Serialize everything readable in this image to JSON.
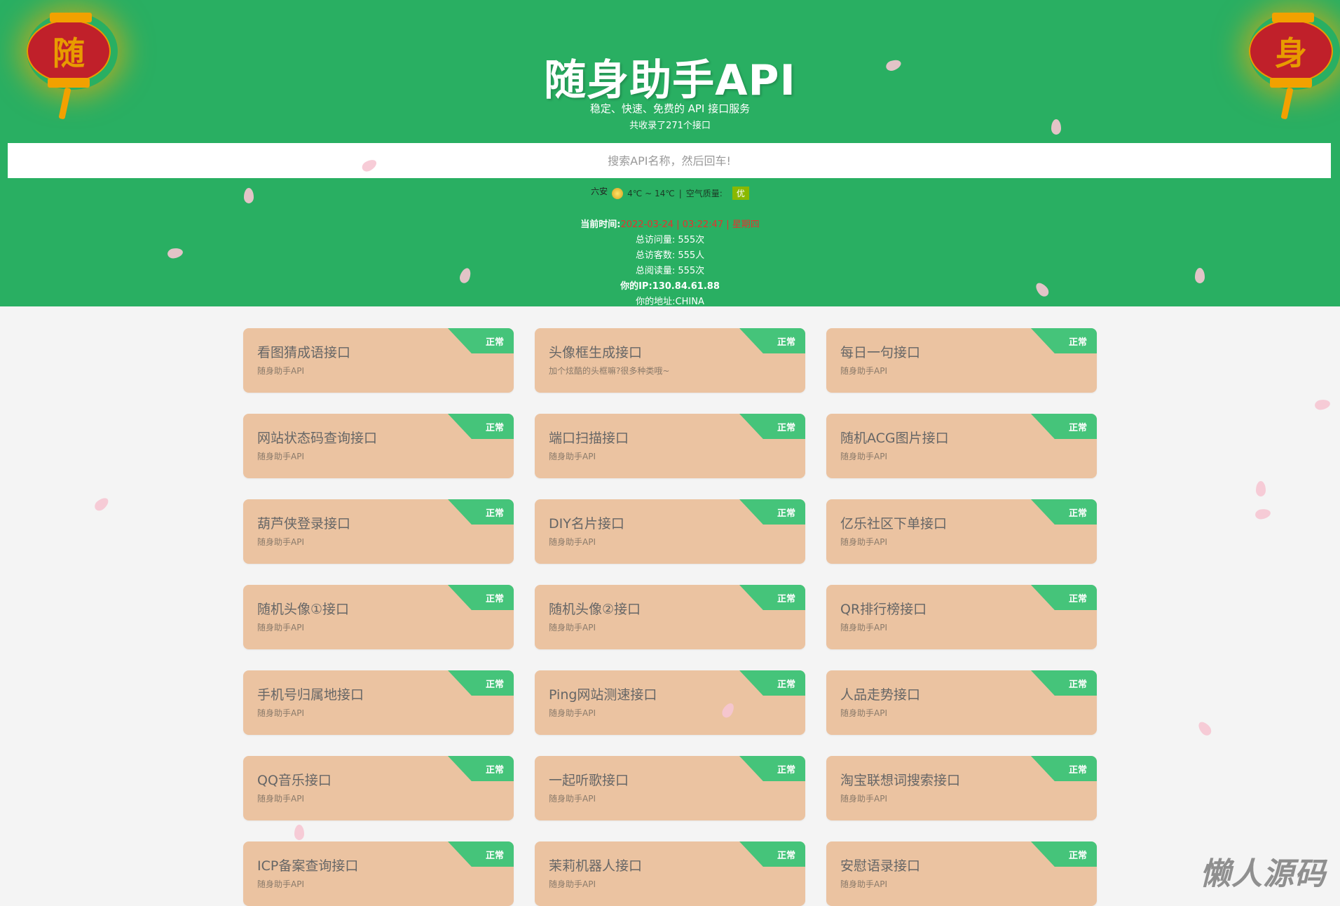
{
  "header": {
    "lantern_left": "随",
    "lantern_right": "身",
    "title": "随身助手API",
    "subtitle": "稳定、快速、免费的 API 接口服务",
    "count": "共收录了271个接口",
    "search_placeholder": "搜索API名称，然后回车!",
    "weather": {
      "city": "六安",
      "icon": "partly-cloudy-icon",
      "temp": "4℃ ~ 14℃",
      "sep": "|",
      "aq_label": "空气质量:",
      "aq_value": "优"
    },
    "time_label": "当前时间:",
    "time_value": "2022-03-24 | 03:22:47 | 星期四",
    "visits": "总访问量: 555次",
    "visitors": "总访客数: 555人",
    "reads": "总阅读量: 555次",
    "ip": "你的IP:130.84.61.88",
    "address": "你的地址:CHINA"
  },
  "cards": [
    {
      "name": "看图猜成语接口",
      "desc": "随身助手API",
      "status": "正常"
    },
    {
      "name": "头像框生成接口",
      "desc": "加个炫酷的头框嘛?很多种类哦~",
      "status": "正常"
    },
    {
      "name": "每日一句接口",
      "desc": "随身助手API",
      "status": "正常"
    },
    {
      "name": "网站状态码查询接口",
      "desc": "随身助手API",
      "status": "正常"
    },
    {
      "name": "端口扫描接口",
      "desc": "随身助手API",
      "status": "正常"
    },
    {
      "name": "随机ACG图片接口",
      "desc": "随身助手API",
      "status": "正常"
    },
    {
      "name": "葫芦侠登录接口",
      "desc": "随身助手API",
      "status": "正常"
    },
    {
      "name": "DIY名片接口",
      "desc": "随身助手API",
      "status": "正常"
    },
    {
      "name": "亿乐社区下单接口",
      "desc": "随身助手API",
      "status": "正常"
    },
    {
      "name": "随机头像①接口",
      "desc": "随身助手API",
      "status": "正常"
    },
    {
      "name": "随机头像②接口",
      "desc": "随身助手API",
      "status": "正常"
    },
    {
      "name": "QR排行榜接口",
      "desc": "随身助手API",
      "status": "正常"
    },
    {
      "name": "手机号归属地接口",
      "desc": "随身助手API",
      "status": "正常"
    },
    {
      "name": "Ping网站测速接口",
      "desc": "随身助手API",
      "status": "正常"
    },
    {
      "name": "人品走势接口",
      "desc": "随身助手API",
      "status": "正常"
    },
    {
      "name": "QQ音乐接口",
      "desc": "随身助手API",
      "status": "正常"
    },
    {
      "name": "一起听歌接口",
      "desc": "随身助手API",
      "status": "正常"
    },
    {
      "name": "淘宝联想词搜索接口",
      "desc": "随身助手API",
      "status": "正常"
    },
    {
      "name": "ICP备案查询接口",
      "desc": "随身助手API",
      "status": "正常"
    },
    {
      "name": "茉莉机器人接口",
      "desc": "随身助手API",
      "status": "正常"
    },
    {
      "name": "安慰语录接口",
      "desc": "随身助手API",
      "status": "正常"
    }
  ],
  "watermark": "懒人源码",
  "colors": {
    "header": "#29af62",
    "card": "#ebc3a1",
    "badge": "#45c47a",
    "time": "#e8302e"
  }
}
